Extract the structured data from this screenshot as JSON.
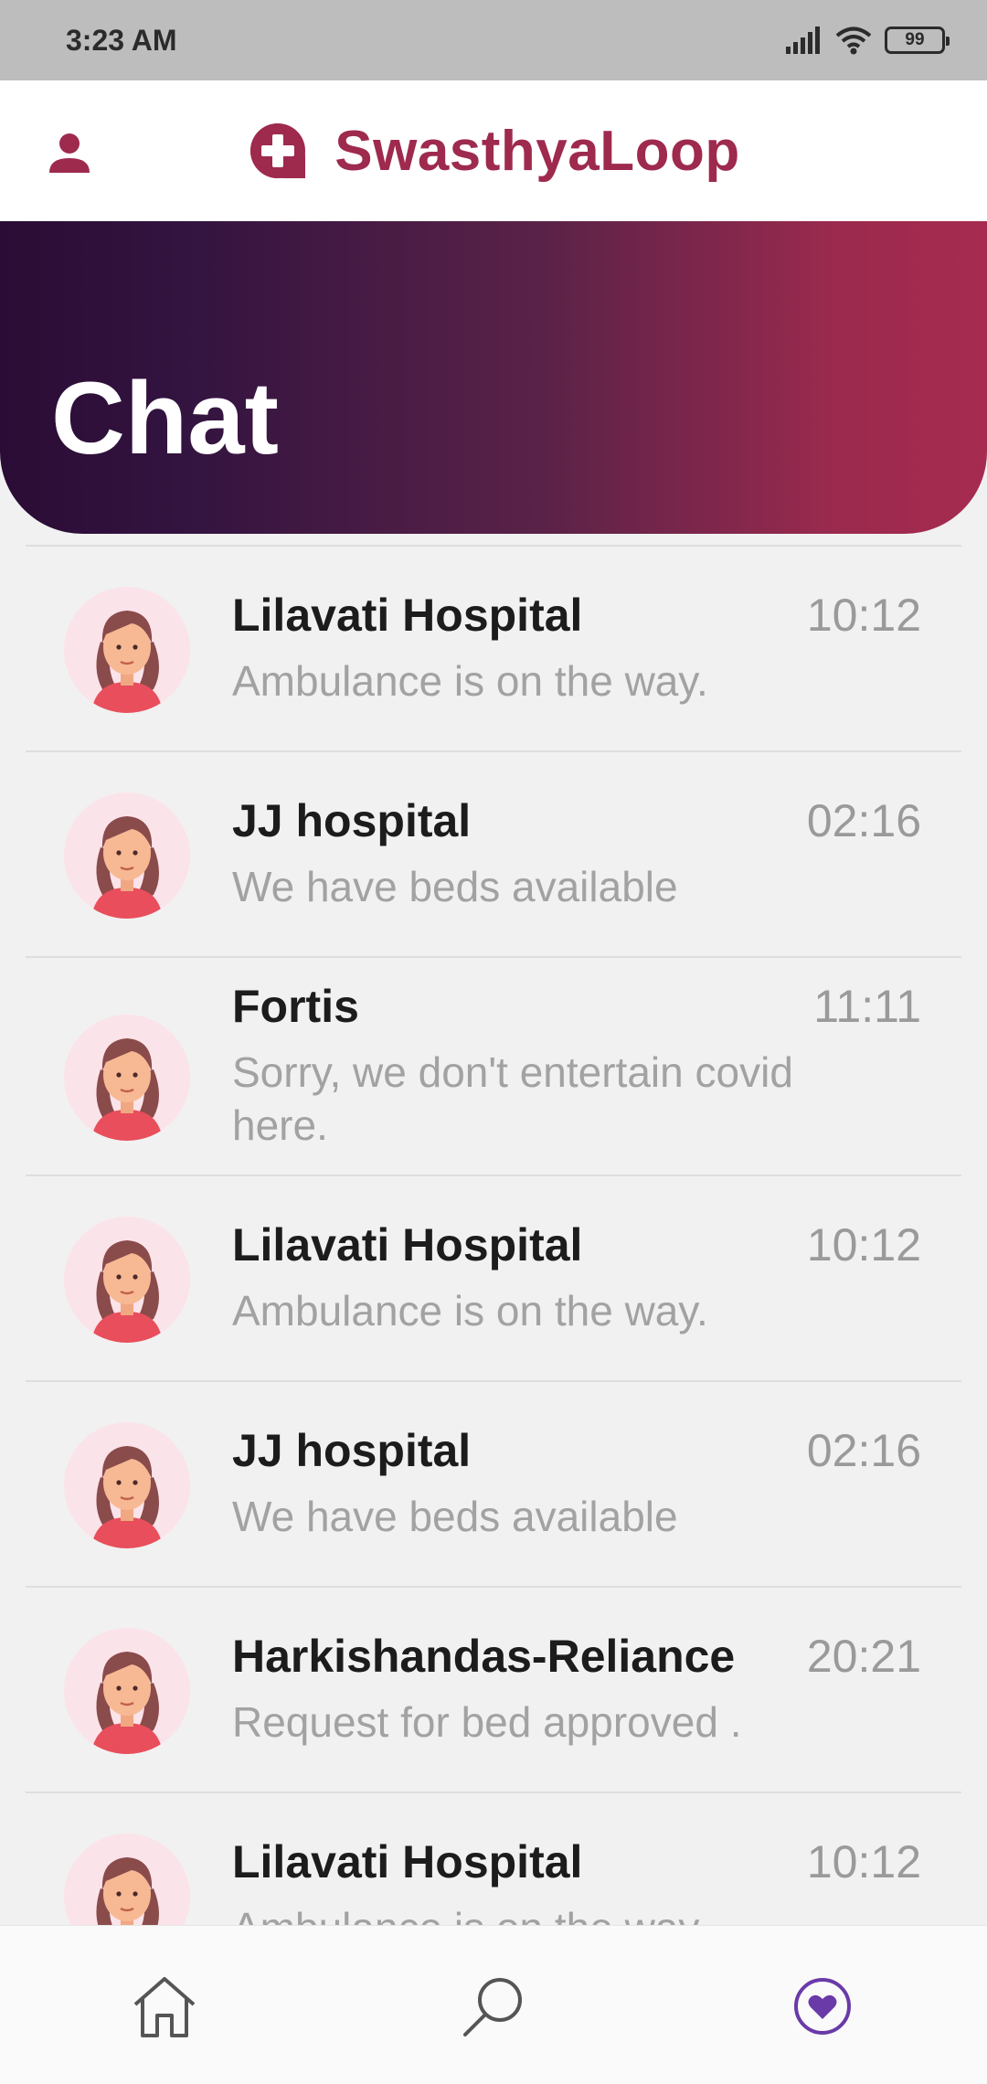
{
  "status_bar": {
    "time": "3:23 AM",
    "battery": "99",
    "icons": [
      "signal-icon",
      "wifi-icon",
      "battery-icon"
    ]
  },
  "app_bar": {
    "brand": "SwasthyaLoop",
    "profile_icon": "person-icon",
    "logo_icon": "medical-cross-icon",
    "brand_color": "#9e2a4e"
  },
  "header": {
    "title": "Chat",
    "gradient_colors": [
      "#2a0c35",
      "#a72b50"
    ]
  },
  "chats": [
    {
      "name": "Lilavati Hospital",
      "time": "10:12",
      "message": "Ambulance is on the way."
    },
    {
      "name": "JJ hospital",
      "time": "02:16",
      "message": "We have beds available"
    },
    {
      "name": "Fortis",
      "time": "11:11",
      "message": "Sorry, we don't entertain covid here."
    },
    {
      "name": "Lilavati Hospital",
      "time": "10:12",
      "message": "Ambulance is on the way."
    },
    {
      "name": "JJ hospital",
      "time": "02:16",
      "message": "We have beds available"
    },
    {
      "name": "Harkishandas-Reliance",
      "time": "20:21",
      "message": "Request for bed approved ."
    },
    {
      "name": "Lilavati Hospital",
      "time": "10:12",
      "message": "Ambulance is on the way."
    }
  ],
  "bottom_nav": {
    "items": [
      {
        "icon": "home-icon",
        "active": false
      },
      {
        "icon": "search-icon",
        "active": false
      },
      {
        "icon": "heart-icon",
        "active": true
      }
    ],
    "active_color": "#6a3aa8",
    "inactive_color": "#555555"
  }
}
